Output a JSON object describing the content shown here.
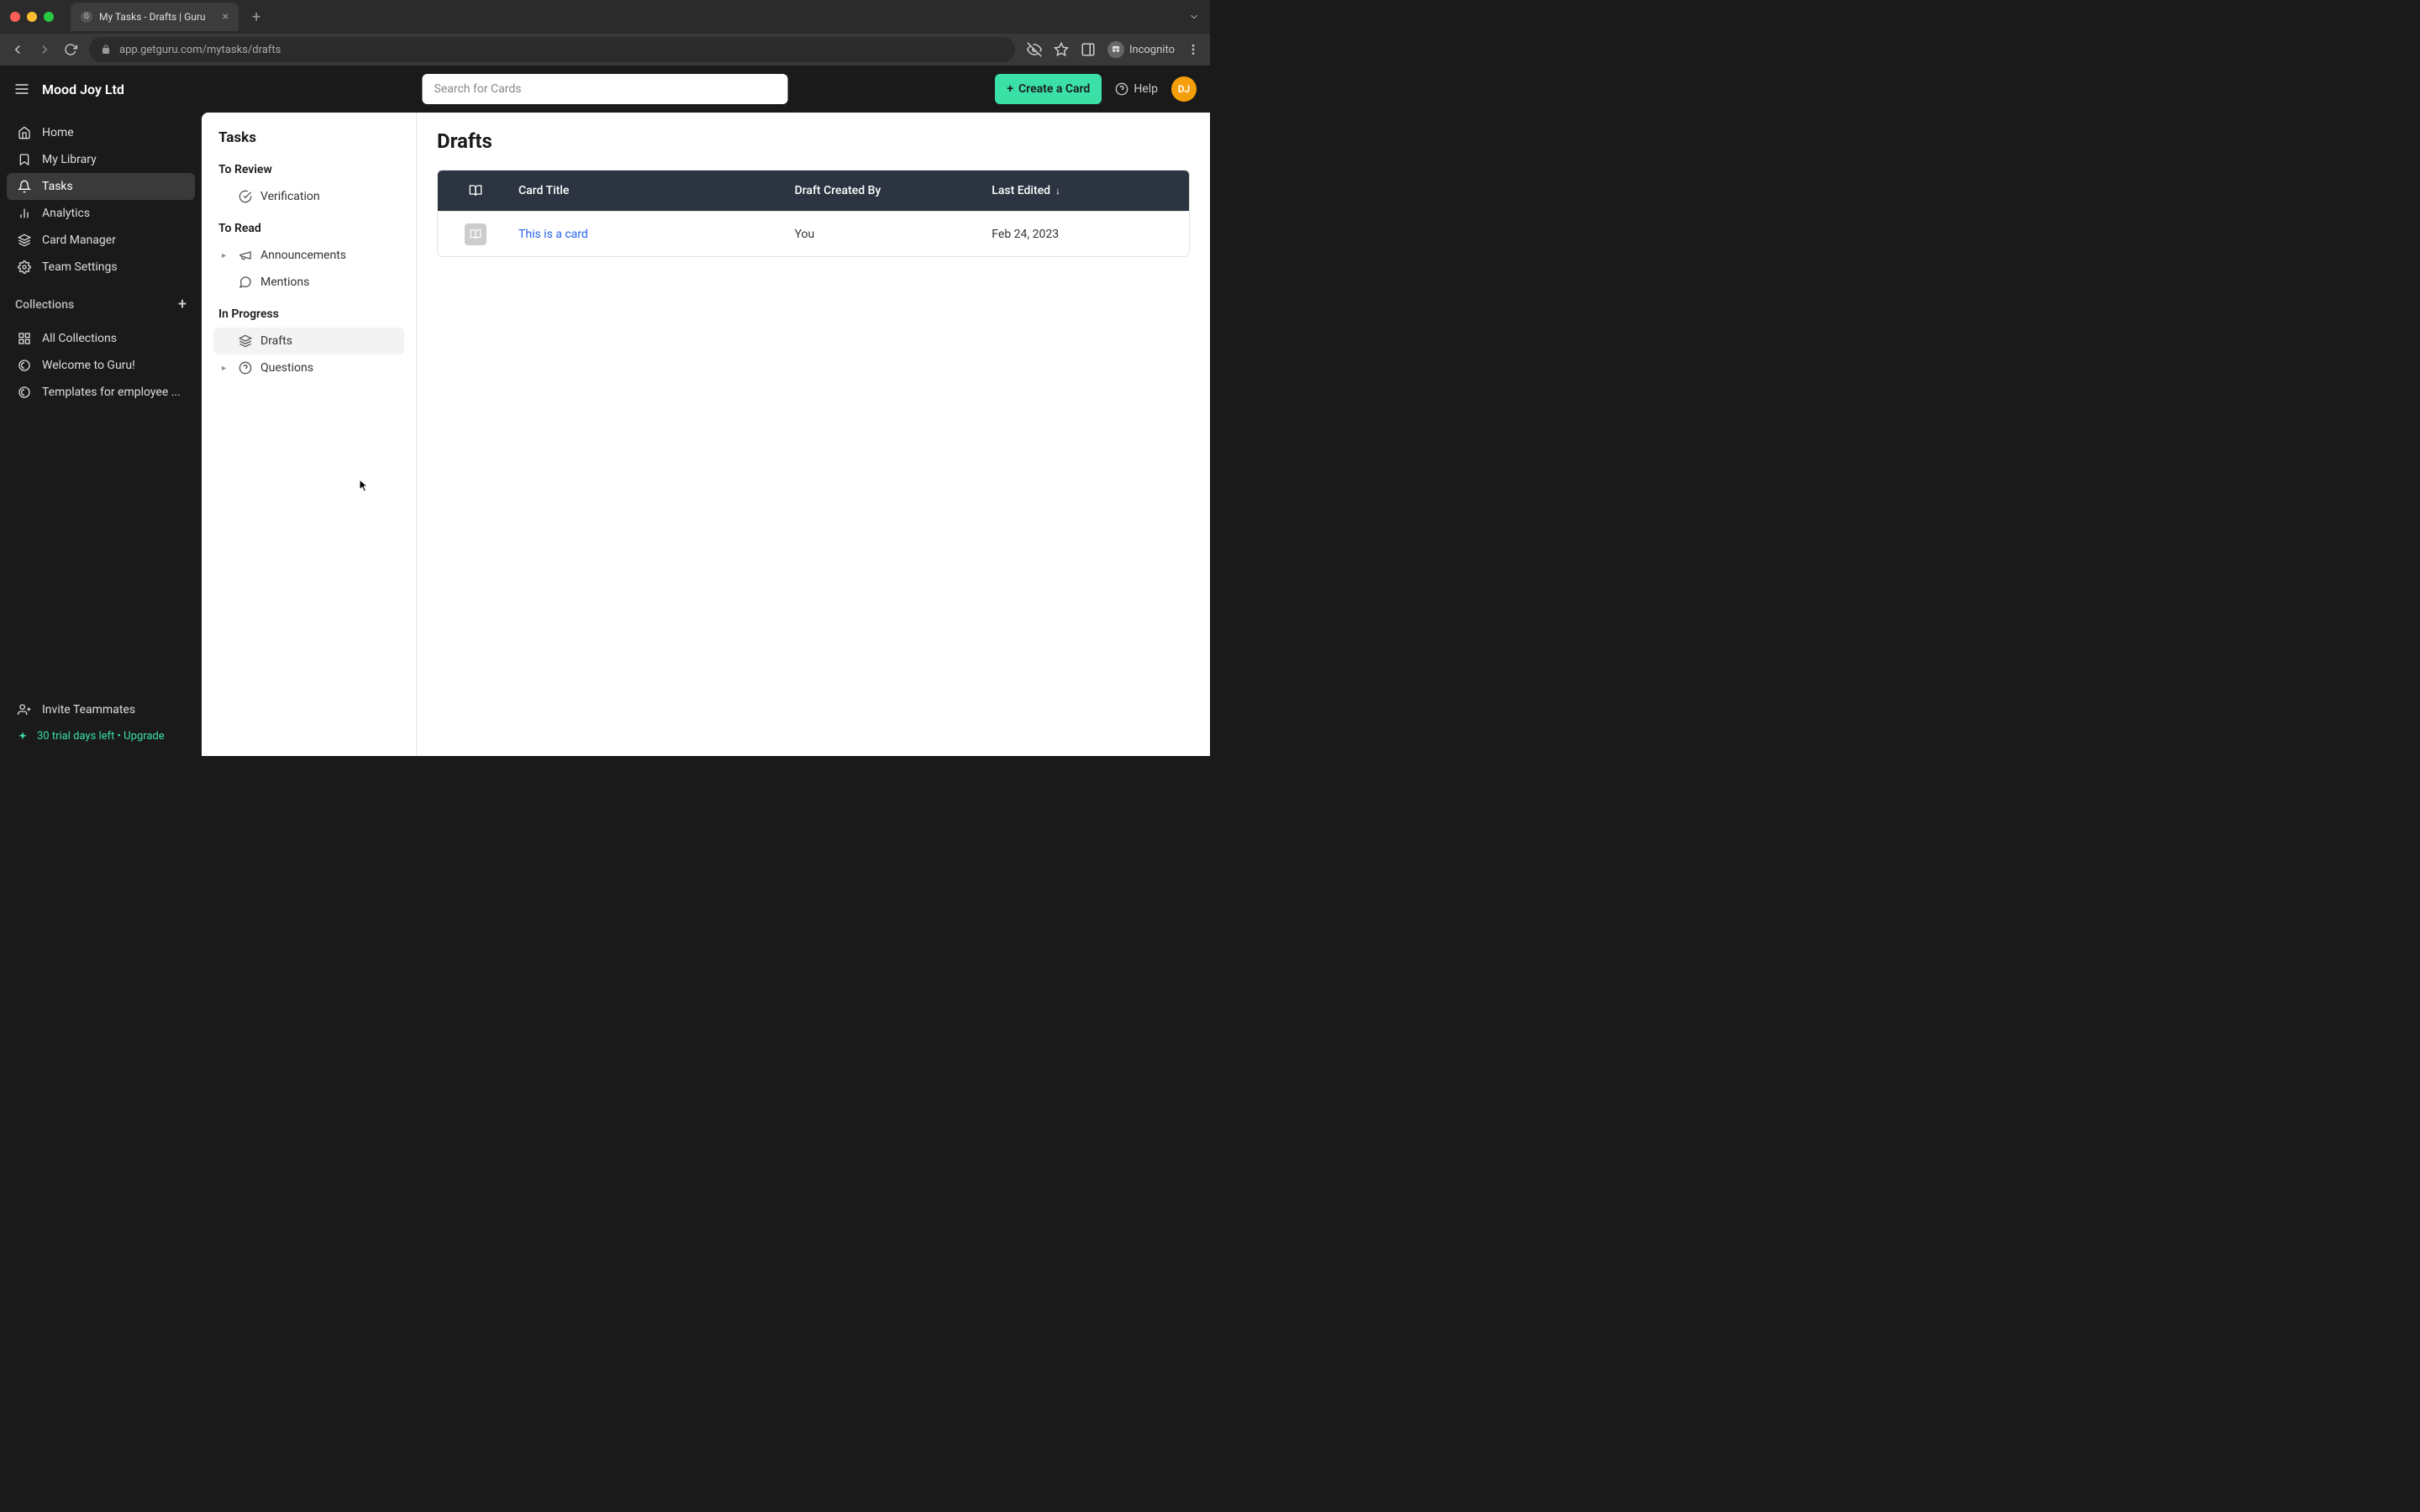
{
  "browser": {
    "tab_title": "My Tasks - Drafts | Guru",
    "url": "app.getguru.com/mytasks/drafts",
    "incognito_label": "Incognito"
  },
  "topbar": {
    "org_name": "Mood Joy Ltd",
    "search_placeholder": "Search for Cards",
    "create_label": "Create a Card",
    "help_label": "Help",
    "avatar_initials": "DJ"
  },
  "sidebar": {
    "nav": [
      {
        "label": "Home",
        "icon": "home"
      },
      {
        "label": "My Library",
        "icon": "bookmark"
      },
      {
        "label": "Tasks",
        "icon": "bell",
        "active": true
      },
      {
        "label": "Analytics",
        "icon": "chart"
      },
      {
        "label": "Card Manager",
        "icon": "layers"
      },
      {
        "label": "Team Settings",
        "icon": "gear"
      }
    ],
    "collections_label": "Collections",
    "collections": [
      {
        "label": "All Collections",
        "icon": "grid"
      },
      {
        "label": "Welcome to Guru!",
        "icon": "guru"
      },
      {
        "label": "Templates for employee ...",
        "icon": "guru"
      }
    ],
    "invite_label": "Invite Teammates",
    "trial_label": "30 trial days left • Upgrade"
  },
  "tasks_panel": {
    "title": "Tasks",
    "groups": [
      {
        "label": "To Review",
        "items": [
          {
            "label": "Verification",
            "icon": "check-circle"
          }
        ]
      },
      {
        "label": "To Read",
        "items": [
          {
            "label": "Announcements",
            "icon": "megaphone",
            "chevron": true
          },
          {
            "label": "Mentions",
            "icon": "chat"
          }
        ]
      },
      {
        "label": "In Progress",
        "items": [
          {
            "label": "Drafts",
            "icon": "layers",
            "active": true
          },
          {
            "label": "Questions",
            "icon": "question",
            "chevron": true
          }
        ]
      }
    ]
  },
  "main": {
    "title": "Drafts",
    "columns": {
      "title": "Card Title",
      "created_by": "Draft Created By",
      "last_edited": "Last Edited"
    },
    "rows": [
      {
        "title": "This is a card",
        "created_by": "You",
        "last_edited": "Feb 24, 2023"
      }
    ]
  }
}
